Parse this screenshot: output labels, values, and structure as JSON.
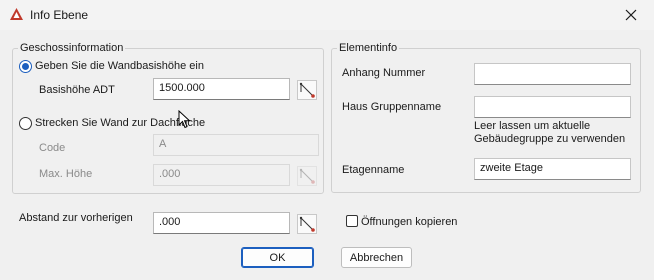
{
  "window": {
    "title": "Info Ebene",
    "app_icon": "autodesk-architecture-icon",
    "close_icon": "close-icon"
  },
  "geschoss": {
    "group_label": "Geschossinformation",
    "option_wandbasis": {
      "label": "Geben Sie die Wandbasishöhe ein",
      "selected": true
    },
    "basishoehe_label": "Basishöhe ADT",
    "basishoehe_value": "1500.000",
    "option_strecken": {
      "label": "Strecken Sie Wand zur Dachfläche",
      "selected": false
    },
    "code_label": "Code",
    "code_value": "A",
    "max_hoehe_label": "Max. Höhe",
    "max_hoehe_value": ".000"
  },
  "element": {
    "group_label": "Elementinfo",
    "anhang_label": "Anhang Nummer",
    "anhang_value": "",
    "haus_label": "Haus Gruppenname",
    "haus_value": "",
    "hint_line1": "Leer lassen um aktuelle",
    "hint_line2": "Gebäudegruppe zu verwenden",
    "etagenname_label": "Etagenname",
    "etagenname_value": "zweite Etage"
  },
  "abstand": {
    "label": "Abstand zur vorherigen",
    "value": ".000"
  },
  "oeffnungen": {
    "label": "Öffnungen kopieren",
    "checked": false
  },
  "buttons": {
    "ok": "OK",
    "abbrechen": "Abbrechen"
  },
  "colors": {
    "accent": "#1c5fbf",
    "icon_red": "#c0392b",
    "window_bg": "#f0f0f0"
  }
}
